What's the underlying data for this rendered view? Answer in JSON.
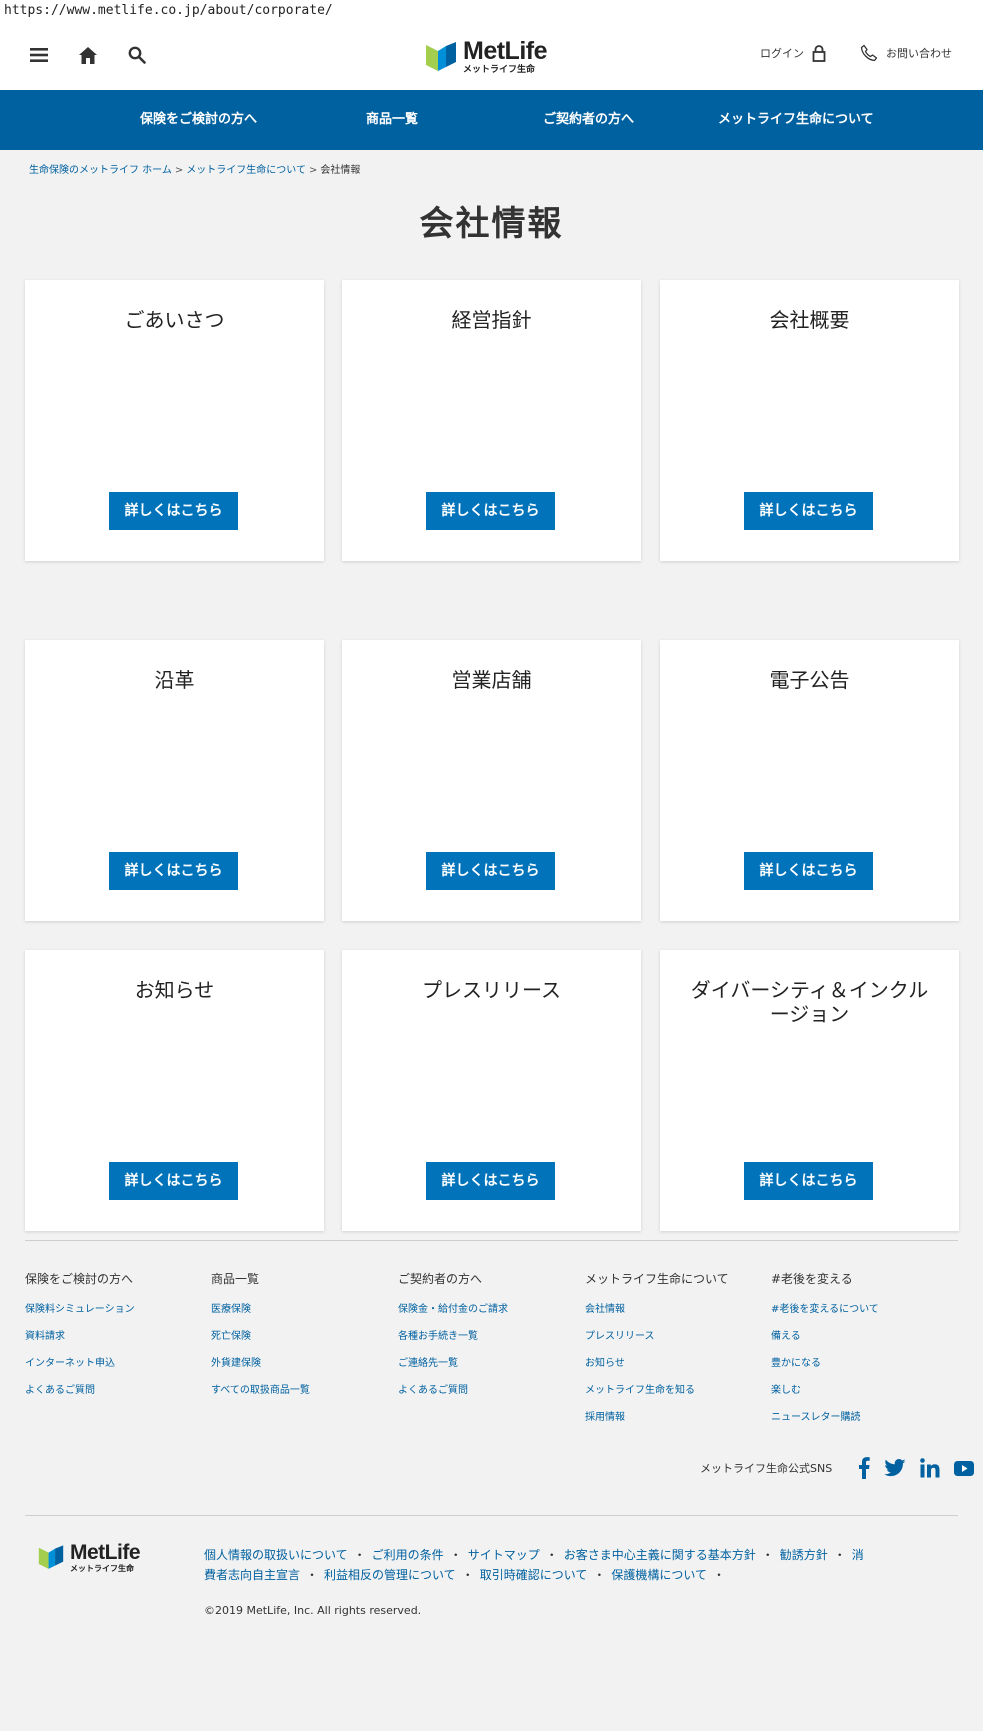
{
  "browser": {
    "url": "https://www.metlife.co.jp/about/corporate/"
  },
  "header": {
    "menu_icon": "hamburger-menu-icon",
    "home_icon": "home-icon",
    "search_icon": "search-icon",
    "logo_main": "MetLife",
    "logo_sub": "メットライフ生命",
    "login_label": "ログイン",
    "contact_label": "お問い合わせ",
    "brand_colors": {
      "blue": "#0061a0",
      "light_blue": "#0090da",
      "green": "#a4ce4e"
    }
  },
  "nav": {
    "items": [
      {
        "label": "保険をご検討の方へ"
      },
      {
        "label": "商品一覧"
      },
      {
        "label": "ご契約者の方へ"
      },
      {
        "label": "メットライフ生命について"
      }
    ],
    "background": "#0061a0"
  },
  "breadcrumb": {
    "items": [
      {
        "label": "生命保険のメットライフ ホーム"
      },
      {
        "label": "メットライフ生命について"
      },
      {
        "label": "会社情報"
      }
    ],
    "separator": ">"
  },
  "page": {
    "title": "会社情報"
  },
  "cards": [
    {
      "title": "ごあいさつ",
      "button": "詳しくはこちら"
    },
    {
      "title": "経営指針",
      "button": "詳しくはこちら"
    },
    {
      "title": "会社概要",
      "button": "詳しくはこちら"
    },
    {
      "title": "沿革",
      "button": "詳しくはこちら"
    },
    {
      "title": "営業店舗",
      "button": "詳しくはこちら"
    },
    {
      "title": "電子公告",
      "button": "詳しくはこちら"
    },
    {
      "title": "お知らせ",
      "button": "詳しくはこちら"
    },
    {
      "title": "プレスリリース",
      "button": "詳しくはこちら"
    },
    {
      "title": "ダイバーシティ＆インクルージョン",
      "button": "詳しくはこちら"
    }
  ],
  "footer": {
    "columns": [
      {
        "title": "保険をご検討の方へ",
        "links": [
          "保険料シミュレーション",
          "資料請求",
          "インターネット申込",
          "よくあるご質問"
        ]
      },
      {
        "title": "商品一覧",
        "links": [
          "医療保険",
          "死亡保険",
          "外貨建保険",
          "すべての取扱商品一覧"
        ]
      },
      {
        "title": "ご契約者の方へ",
        "links": [
          "保険金・給付金のご請求",
          "各種お手続き一覧",
          "ご連絡先一覧",
          "よくあるご質問"
        ]
      },
      {
        "title": "メットライフ生命について",
        "links": [
          "会社情報",
          "プレスリリース",
          "お知らせ",
          "メットライフ生命を知る",
          "採用情報"
        ]
      },
      {
        "title": "#老後を変える",
        "links": [
          "#老後を変えるについて",
          "備える",
          "豊かになる",
          "楽しむ",
          "ニュースレター購読"
        ]
      }
    ],
    "sns_label": "メットライフ生命公式SNS",
    "sns_icons": [
      "facebook-icon",
      "twitter-icon",
      "linkedin-icon",
      "youtube-icon"
    ],
    "legal_links": [
      "個人情報の取扱いについて",
      "ご利用の条件",
      "サイトマップ",
      "お客さま中心主義に関する基本方針",
      "勧誘方針",
      "消費者志向自主宣言",
      "利益相反の管理について",
      "取引時確認について",
      "保護機構について"
    ],
    "copyright": "©2019 MetLife, Inc. All rights reserved."
  }
}
